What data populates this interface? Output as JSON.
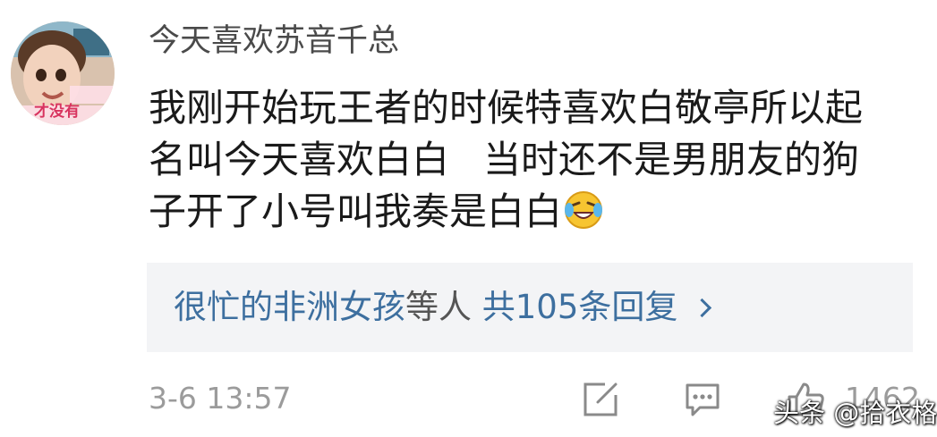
{
  "comment": {
    "username": "今天喜欢苏音千总",
    "avatar_caption": "才没有",
    "text_lines": [
      "我刚开始玩王者的时候特喜欢白敬亭所以起",
      "名叫今天喜欢白白",
      "当时还不是男朋友的狗",
      "子开了小号叫我奏是白白"
    ],
    "emoji": "laugh-cry-emoji",
    "timestamp": "3-6 13:57"
  },
  "replies": {
    "users": "很忙的非洲女孩",
    "mid": "等人",
    "count_text": "共105条回复"
  },
  "actions": {
    "like_count": "1462"
  },
  "watermark": {
    "text": "头条 @拾衣格"
  },
  "colors": {
    "link": "#3d6f9f",
    "meta": "#9b9b9b",
    "reply_bg": "#f3f4f6",
    "body_text": "#1a1a1a"
  }
}
